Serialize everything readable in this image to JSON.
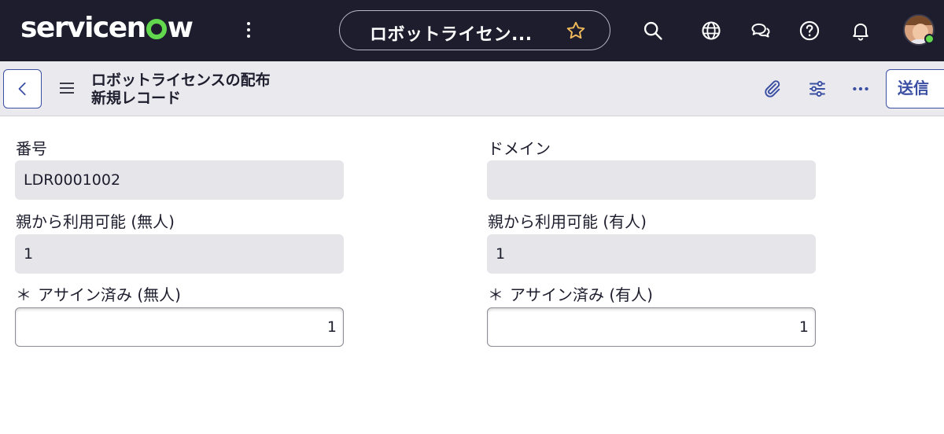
{
  "nav": {
    "logo_text_before": "servicen",
    "logo_text_after": "w",
    "logo_accent_color": "#62d84e",
    "record_pill_title": "ロボットライセン...",
    "icons": [
      "more-vertical-icon",
      "star-icon",
      "search-icon",
      "globe-icon",
      "chat-icon",
      "help-icon",
      "bell-icon"
    ]
  },
  "header": {
    "title_line1": "ロボットライセンスの配布",
    "title_line2": "新規レコード",
    "submit_label": "送信"
  },
  "form": {
    "left": [
      {
        "label": "番号",
        "value": "LDR0001002",
        "type": "readonly"
      },
      {
        "label": "親から利用可能 (無人)",
        "value": "1",
        "type": "readonly"
      },
      {
        "label": "アサイン済み (無人)",
        "value": "1",
        "type": "input",
        "required": true
      }
    ],
    "right": [
      {
        "label": "ドメイン",
        "value": "",
        "type": "readonly"
      },
      {
        "label": "親から利用可能 (有人)",
        "value": "1",
        "type": "readonly"
      },
      {
        "label": "アサイン済み (有人)",
        "value": "1",
        "type": "input",
        "required": true
      }
    ],
    "required_marker": "＊"
  },
  "colors": {
    "topbar": "#1d1d2e",
    "accent": "#3b4fa3",
    "readonly_bg": "#e6e6ea"
  }
}
